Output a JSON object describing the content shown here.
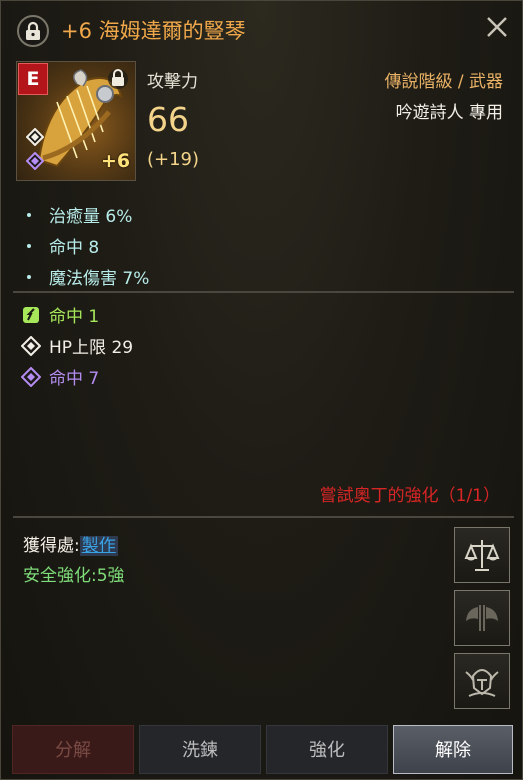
{
  "item": {
    "title": "+6 海姆達爾的豎琴",
    "grade_letter": "E",
    "enhance_label": "+6",
    "stat_label": "攻擊力",
    "stat_value": "66",
    "stat_bonus": "(+19)",
    "grade_type": "傳說階級 / 武器",
    "class_restriction": "吟遊詩人 專用"
  },
  "bonus_stats": [
    {
      "label": "治癒量 6%"
    },
    {
      "label": "命中 8"
    },
    {
      "label": "魔法傷害 7%"
    }
  ],
  "gem_stats": [
    {
      "label": "命中 1",
      "color": "#a6e85a",
      "icon": "green-rune-icon"
    },
    {
      "label": "HP上限 29",
      "color": "#f2efe6",
      "icon": "white-diamond-icon"
    },
    {
      "label": "命中 7",
      "color": "#b48cf2",
      "icon": "purple-diamond-icon"
    }
  ],
  "odin": "嘗試奧丁的強化（1/1）",
  "source": {
    "label": "獲得處:",
    "link": "製作"
  },
  "safe_enhance": "安全強化:5強",
  "buttons": {
    "disassemble": "分解",
    "reroll": "洗鍊",
    "enhance": "強化",
    "release": "解除"
  },
  "colors": {
    "title": "#f0a84a",
    "odin": "#d82525",
    "safe": "#7fdd7a",
    "link": "#3aa3e6"
  }
}
